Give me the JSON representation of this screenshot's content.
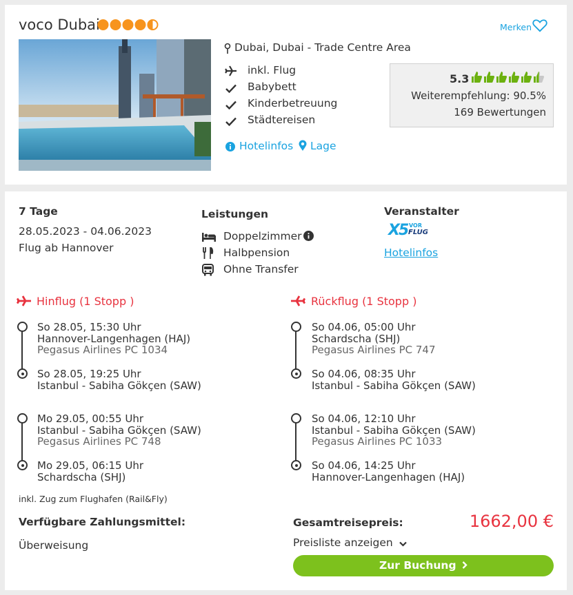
{
  "hotel": {
    "name": "voco Dubai",
    "stars": 4.5,
    "merken_label": "Merken",
    "location": "Dubai, Dubai - Trade Centre Area",
    "features": [
      "inkl. Flug",
      "Babybett",
      "Kinderbetreuung",
      "Städtereisen"
    ],
    "links": {
      "hotelinfos": "Hotelinfos",
      "lage": "Lage"
    },
    "rating": {
      "score": "5.3",
      "thumbs_filled": 5.5,
      "thumbs_total": 6,
      "recommendation": "Weiterempfehlung: 90.5%",
      "reviews": "169 Bewertungen"
    }
  },
  "offer": {
    "duration": "7 Tage",
    "dates": "28.05.2023 - 04.06.2023",
    "departure": "Flug ab Hannover",
    "services_title": "Leistungen",
    "services": {
      "room": "Doppelzimmer",
      "board": "Halbpension",
      "transfer": "Ohne Transfer"
    },
    "operator_title": "Veranstalter",
    "operator_logo": {
      "big": "X5",
      "small_top": "VOR",
      "small_bottom": "FLUG"
    },
    "operator_link": "Hotelinfos",
    "outbound": {
      "title": "Hinflug (1 Stopp )",
      "legs": [
        {
          "dep_time": "So 28.05, 15:30 Uhr",
          "dep_airport": "Hannover-Langenhagen (HAJ)",
          "airline": "Pegasus Airlines PC 1034",
          "arr_time": "So 28.05, 19:25 Uhr",
          "arr_airport": "Istanbul - Sabiha Gökçen (SAW)"
        },
        {
          "dep_time": "Mo 29.05, 00:55 Uhr",
          "dep_airport": "Istanbul - Sabiha Gökçen (SAW)",
          "airline": "Pegasus Airlines PC 748",
          "arr_time": "Mo 29.05, 06:15 Uhr",
          "arr_airport": "Schardscha (SHJ)"
        }
      ]
    },
    "return": {
      "title": "Rückflug (1 Stopp )",
      "legs": [
        {
          "dep_time": "So 04.06, 05:00 Uhr",
          "dep_airport": "Schardscha (SHJ)",
          "airline": "Pegasus Airlines PC 747",
          "arr_time": "So 04.06, 08:35 Uhr",
          "arr_airport": "Istanbul - Sabiha Gökçen (SAW)"
        },
        {
          "dep_time": "So 04.06, 12:10 Uhr",
          "dep_airport": "Istanbul - Sabiha Gökçen (SAW)",
          "airline": "Pegasus Airlines PC 1033",
          "arr_time": "So 04.06, 14:25 Uhr",
          "arr_airport": "Hannover-Langenhagen (HAJ)"
        }
      ]
    },
    "rail_fly": "inkl. Zug zum Flughafen (Rail&Fly)",
    "payment_title": "Verfügbare Zahlungsmittel:",
    "payment_method": "Überweisung",
    "total_label": "Gesamtreisepreis:",
    "total_price": "1662,00 €",
    "price_list_label": "Preisliste anzeigen",
    "book_label": "Zur Buchung"
  },
  "colors": {
    "accent_blue": "#1aa3e0",
    "star_orange": "#f7941d",
    "thumb_green": "#6cb10f",
    "flight_red": "#e8333f",
    "book_green": "#7dc11d"
  }
}
